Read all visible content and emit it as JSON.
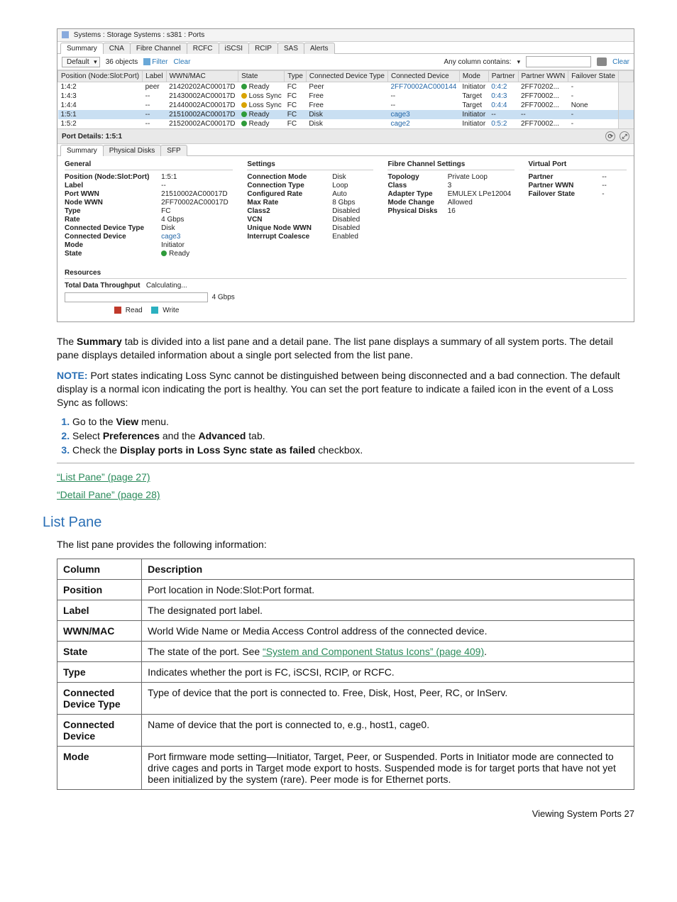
{
  "app": {
    "title": "Systems : Storage Systems : s381 : Ports",
    "outerTabs": [
      "Summary",
      "CNA",
      "Fibre Channel",
      "RCFC",
      "iSCSI",
      "RCIP",
      "SAS",
      "Alerts"
    ],
    "toolbar": {
      "default": "Default",
      "objects": "36 objects",
      "filter": "Filter",
      "clearTop": "Clear",
      "anyCol": "Any column contains:",
      "clearRight": "Clear"
    },
    "gridHeaders": [
      "Position (Node:Slot:Port)",
      "Label",
      "WWN/MAC",
      "State",
      "Type",
      "Connected Device Type",
      "Connected Device",
      "Mode",
      "Partner",
      "Partner WWN",
      "Failover State"
    ],
    "rows": [
      {
        "pos": "1:4:2",
        "label": "peer",
        "wwn": "21420202AC00017D",
        "state": "Ready",
        "stateDot": "green",
        "type": "FC",
        "cdt": "Peer",
        "cd": "2FF70002AC000144",
        "mode": "Initiator",
        "partner": "0:4:2",
        "pwwn": "2FF70202...",
        "fail": "-"
      },
      {
        "pos": "1:4:3",
        "label": "--",
        "wwn": "21430002AC00017D",
        "state": "Loss Sync",
        "stateDot": "amber",
        "type": "FC",
        "cdt": "Free",
        "cd": "--",
        "mode": "Target",
        "partner": "0:4:3",
        "pwwn": "2FF70002...",
        "fail": "-"
      },
      {
        "pos": "1:4:4",
        "label": "--",
        "wwn": "21440002AC00017D",
        "state": "Loss Sync",
        "stateDot": "amber",
        "type": "FC",
        "cdt": "Free",
        "cd": "--",
        "mode": "Target",
        "partner": "0:4:4",
        "pwwn": "2FF70002...",
        "fail": "None"
      },
      {
        "pos": "1:5:1",
        "label": "--",
        "wwn": "21510002AC00017D",
        "state": "Ready",
        "stateDot": "green",
        "type": "FC",
        "cdt": "Disk",
        "cd": "cage3",
        "mode": "Initiator",
        "partner": "--",
        "pwwn": "--",
        "fail": "-",
        "sel": true
      },
      {
        "pos": "1:5:2",
        "label": "--",
        "wwn": "21520002AC00017D",
        "state": "Ready",
        "stateDot": "green",
        "type": "FC",
        "cdt": "Disk",
        "cd": "cage2",
        "mode": "Initiator",
        "partner": "0:5:2",
        "pwwn": "2FF70002...",
        "fail": "-"
      }
    ],
    "detailTitle": "Port Details: 1:5:1",
    "innerTabs": [
      "Summary",
      "Physical Disks",
      "SFP"
    ],
    "general": {
      "title": "General",
      "items": [
        [
          "Position (Node:Slot:Port)",
          "1:5:1"
        ],
        [
          "Label",
          "--"
        ],
        [
          "Port WWN",
          "21510002AC00017D"
        ],
        [
          "Node WWN",
          "2FF70002AC00017D"
        ],
        [
          "Type",
          "FC"
        ],
        [
          "Rate",
          "4 Gbps"
        ],
        [
          "Connected Device Type",
          "Disk"
        ],
        [
          "Connected Device",
          "cage3"
        ],
        [
          "Mode",
          "Initiator"
        ],
        [
          "State",
          "Ready"
        ]
      ]
    },
    "settings": {
      "title": "Settings",
      "items": [
        [
          "Connection Mode",
          "Disk"
        ],
        [
          "Connection Type",
          "Loop"
        ],
        [
          "Configured Rate",
          "Auto"
        ],
        [
          "Max Rate",
          "8 Gbps"
        ],
        [
          "Class2",
          "Disabled"
        ],
        [
          "VCN",
          "Disabled"
        ],
        [
          "Unique Node WWN",
          "Disabled"
        ],
        [
          "Interrupt Coalesce",
          "Enabled"
        ]
      ]
    },
    "fc": {
      "title": "Fibre Channel Settings",
      "items": [
        [
          "Topology",
          "Private Loop"
        ],
        [
          "Class",
          "3"
        ],
        [
          "Adapter Type",
          "EMULEX LPe12004"
        ],
        [
          "Mode Change",
          "Allowed"
        ],
        [
          "Physical Disks",
          "16"
        ]
      ]
    },
    "vport": {
      "title": "Virtual Port",
      "items": [
        [
          "Partner",
          "--"
        ],
        [
          "Partner WWN",
          "--"
        ],
        [
          "Failover State",
          "-"
        ]
      ]
    },
    "resources": {
      "title": "Resources",
      "throughputLabel": "Total Data Throughput",
      "throughputValue": "Calculating...",
      "rateLabel": "4 Gbps",
      "legendRead": "Read",
      "legendWrite": "Write"
    }
  },
  "body": {
    "p1a": "The ",
    "p1b": "Summary",
    "p1c": " tab is divided into a list pane and a detail pane. The list pane displays a summary of all system ports. The detail pane displays detailed information about a single port selected from the list pane.",
    "noteLabel": "NOTE:",
    "noteText": " Port states indicating Loss Sync cannot be distinguished between being disconnected and a bad connection. The default display is a normal icon indicating the port is healthy. You can set the port feature to indicate a failed icon in the event of a Loss Sync as follows:",
    "step1a": "Go to the ",
    "step1b": "View",
    "step1c": " menu.",
    "step2a": "Select ",
    "step2b": "Preferences",
    "step2c": " and the ",
    "step2d": "Advanced",
    "step2e": " tab.",
    "step3a": "Check the ",
    "step3b": "Display ports in Loss Sync state as failed",
    "step3c": " checkbox.",
    "link1": "“List Pane” (page 27)",
    "link2": "“Detail Pane” (page 28)",
    "sectionTitle": "List Pane",
    "sectionIntro": "The list pane provides the following information:",
    "tableHeaders": [
      "Column",
      "Description"
    ],
    "tableRows": [
      [
        "Position",
        "Port location in Node:Slot:Port format."
      ],
      [
        "Label",
        "The designated port label."
      ],
      [
        "WWN/MAC",
        "World Wide Name or Media Access Control address of the connected device."
      ],
      [
        "State",
        "The state of the port. See |“System and Component Status Icons” (page 409)|."
      ],
      [
        "Type",
        "Indicates whether the port is FC, iSCSI, RCIP, or RCFC."
      ],
      [
        "Connected Device Type",
        "Type of device that the port is connected to. Free, Disk, Host, Peer, RC, or InServ."
      ],
      [
        "Connected Device",
        "Name of device that the port is connected to, e.g., host1, cage0."
      ],
      [
        "Mode",
        "Port firmware mode setting—Initiator, Target, Peer, or Suspended. Ports in Initiator mode are connected to drive cages and ports in Target mode export to hosts. Suspended mode is for target ports that have not yet been initialized by the system (rare). Peer mode is for Ethernet ports."
      ]
    ],
    "footer": "Viewing System Ports    27"
  }
}
